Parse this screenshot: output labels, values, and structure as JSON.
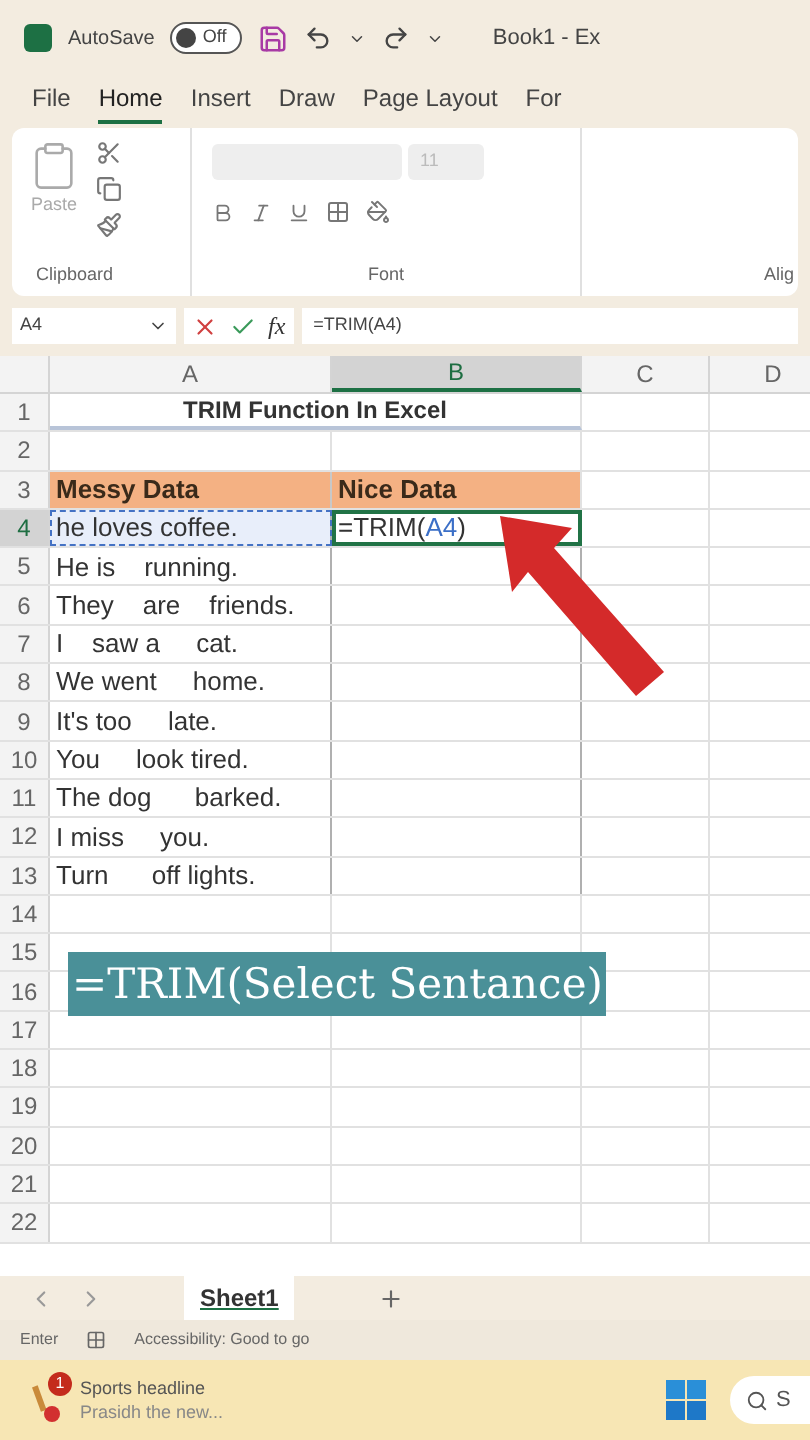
{
  "title_bar": {
    "autosave_label": "AutoSave",
    "autosave_on": false,
    "toggle_text": "Off",
    "title": "Book1 - Ex"
  },
  "ribbon_tabs": [
    {
      "label": "File",
      "selected": false
    },
    {
      "label": "Home",
      "selected": true
    },
    {
      "label": "Insert",
      "selected": false
    },
    {
      "label": "Draw",
      "selected": false
    },
    {
      "label": "Page Layout",
      "selected": false
    },
    {
      "label": "For",
      "selected": false
    }
  ],
  "ribbon": {
    "paste_label": "Paste",
    "font_size": "11",
    "groups": [
      "Clipboard",
      "Font",
      "Alig"
    ]
  },
  "formula_bar": {
    "name_box": "A4",
    "fx": "fx",
    "formula": "=TRIM(A4)"
  },
  "columns": [
    {
      "label": "A",
      "selected": false
    },
    {
      "label": "B",
      "selected": true
    },
    {
      "label": "C",
      "selected": false
    },
    {
      "label": "D",
      "selected": false
    }
  ],
  "rows": [
    {
      "number": "1",
      "selected": false,
      "kind": "title",
      "a": "TRIM Function In Excel"
    },
    {
      "number": "2",
      "selected": false,
      "kind": "empty"
    },
    {
      "number": "3",
      "selected": false,
      "kind": "header",
      "a": "Messy Data",
      "b": "Nice Data"
    },
    {
      "number": "4",
      "selected": true,
      "kind": "data",
      "a": "he loves coffee.",
      "a_referenced": true,
      "b_formula": {
        "prefix": "=TRIM(",
        "ref": "A4",
        "suffix": ")"
      },
      "b_selected": true
    },
    {
      "number": "5",
      "selected": false,
      "kind": "data",
      "a": "He is    running."
    },
    {
      "number": "6",
      "selected": false,
      "kind": "data",
      "a": "They    are    friends."
    },
    {
      "number": "7",
      "selected": false,
      "kind": "data",
      "a": "I    saw a     cat."
    },
    {
      "number": "8",
      "selected": false,
      "kind": "data",
      "a": "We went     home."
    },
    {
      "number": "9",
      "selected": false,
      "kind": "data",
      "a": "It's too     late."
    },
    {
      "number": "10",
      "selected": false,
      "kind": "data",
      "a": "You     look tired."
    },
    {
      "number": "11",
      "selected": false,
      "kind": "data",
      "a": "The dog      barked."
    },
    {
      "number": "12",
      "selected": false,
      "kind": "data",
      "a": "I miss     you."
    },
    {
      "number": "13",
      "selected": false,
      "kind": "data",
      "a": "Turn      off lights."
    },
    {
      "number": "14",
      "selected": false,
      "kind": "empty"
    },
    {
      "number": "15",
      "selected": false,
      "kind": "empty"
    },
    {
      "number": "16",
      "selected": false,
      "kind": "empty"
    },
    {
      "number": "17",
      "selected": false,
      "kind": "empty"
    },
    {
      "number": "18",
      "selected": false,
      "kind": "empty"
    },
    {
      "number": "19",
      "selected": false,
      "kind": "empty"
    },
    {
      "number": "20",
      "selected": false,
      "kind": "empty"
    },
    {
      "number": "21",
      "selected": false,
      "kind": "empty"
    },
    {
      "number": "22",
      "selected": false,
      "kind": "empty"
    }
  ],
  "caption": "=TRIM(Select Sentance)",
  "sheet_tabs": [
    {
      "label": "Sheet1",
      "selected": true
    }
  ],
  "status_bar": {
    "mode": "Enter",
    "accessibility": "Accessibility: Good to go"
  },
  "taskbar": {
    "badge": "1",
    "headline": "Sports headline",
    "subtitle": "Prasidh the new...",
    "search": "S"
  }
}
